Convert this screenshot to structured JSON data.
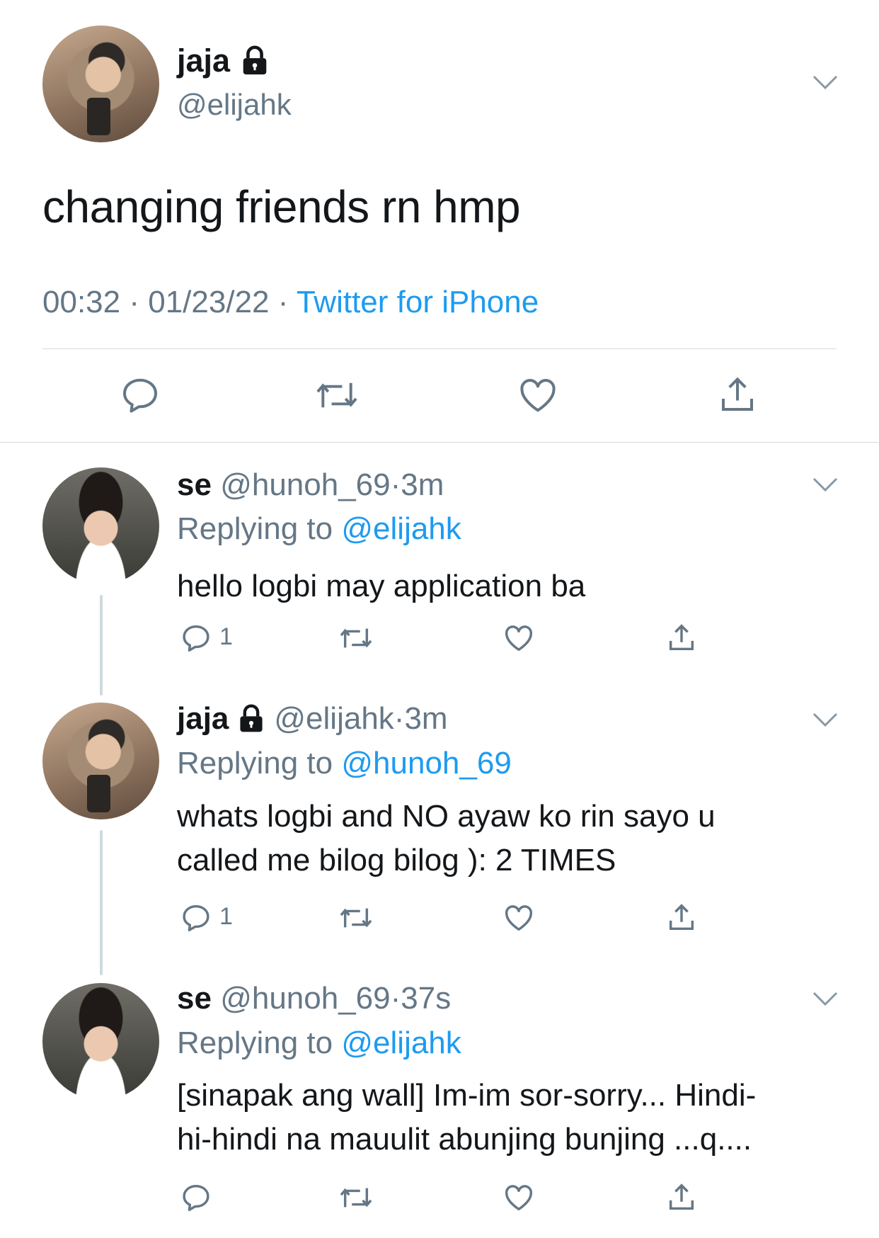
{
  "main_tweet": {
    "display_name": "jaja",
    "handle": "@elijahk",
    "text": "changing friends rn hmp",
    "time": "00:32",
    "date": "01/23/22",
    "separator": "·",
    "source": "Twitter for iPhone"
  },
  "replies": [
    {
      "display_name": "se",
      "handle": "@hunoh_69",
      "dot": "·",
      "age": "3m",
      "replying_prefix": "Replying to",
      "replying_to": "@elijahk",
      "text_lines": [
        "hello logbi may application ba"
      ],
      "reply_count": "1"
    },
    {
      "display_name": "jaja",
      "handle": "@elijahk",
      "dot": "·",
      "age": "3m",
      "replying_prefix": "Replying to",
      "replying_to": "@hunoh_69",
      "text_lines": [
        "whats logbi and NO ayaw ko rin sayo u",
        "called me bilog bilog ): 2 TIMES"
      ],
      "reply_count": "1"
    },
    {
      "display_name": "se",
      "handle": "@hunoh_69",
      "dot": "·",
      "age": "37s",
      "replying_prefix": "Replying to",
      "replying_to": "@elijahk",
      "text_lines": [
        "[sinapak ang wall] Im-im sor-sorry... Hindi-",
        "hi-hindi na mauulit abunjing bunjing ...q...."
      ],
      "reply_count": ""
    }
  ],
  "colors": {
    "link": "#1d9bf0",
    "secondary_text": "#657786",
    "primary_text": "#14171a"
  },
  "icons": [
    "lock-icon",
    "chevron-down-icon",
    "reply-icon",
    "retweet-icon",
    "like-icon",
    "share-icon"
  ]
}
